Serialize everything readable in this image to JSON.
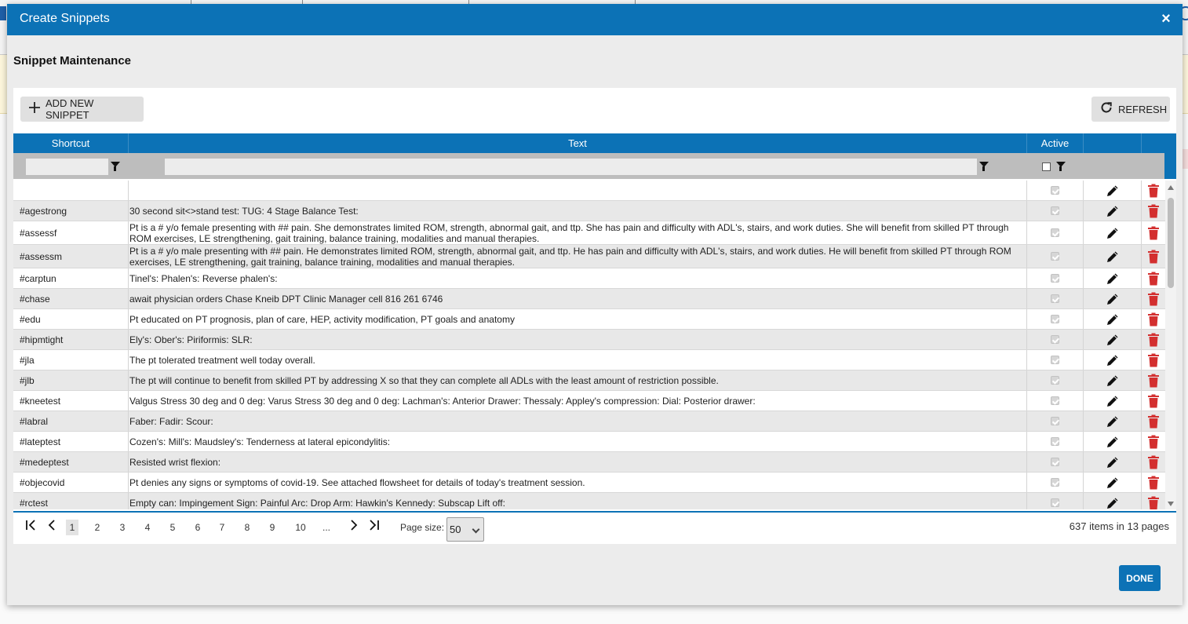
{
  "dialog": {
    "title": "Create Snippets",
    "close_glyph": "×",
    "section_title": "Snippet Maintenance",
    "done_label": "DONE"
  },
  "toolbar": {
    "add_label": "ADD NEW SNIPPET",
    "add_icon": "plus-icon",
    "refresh_label": "REFRESH",
    "refresh_icon": "refresh-icon"
  },
  "grid": {
    "columns": [
      "Shortcut",
      "Text",
      "Active"
    ],
    "rows": [
      {
        "shortcut": "",
        "text": "",
        "active": true
      },
      {
        "shortcut": "#agestrong",
        "text": "30 second sit<>stand test: TUG: 4 Stage Balance Test:",
        "active": true
      },
      {
        "shortcut": "#assessf",
        "text": "Pt is a # y/o female presenting with ## pain. She demonstrates limited ROM, strength, abnormal gait, and ttp. She has pain and difficulty with ADL's, stairs, and work duties. She will benefit from skilled PT through ROM exercises, LE strengthening, gait training, balance training, modalities and manual therapies.",
        "active": true
      },
      {
        "shortcut": "#assessm",
        "text": "Pt is a # y/o male presenting with ## pain. He demonstrates limited ROM, strength, abnormal gait, and ttp. He has pain and difficulty with ADL's, stairs, and work duties. He will benefit from skilled PT through ROM exercises, LE strengthening, gait training, balance training, modalities and manual therapies.",
        "active": true
      },
      {
        "shortcut": "#carptun",
        "text": "Tinel's: Phalen's: Reverse phalen's:",
        "active": true
      },
      {
        "shortcut": "#chase",
        "text": "await physician orders Chase Kneib DPT Clinic Manager cell 816 261 6746",
        "active": true
      },
      {
        "shortcut": "#edu",
        "text": "Pt educated on PT prognosis, plan of care, HEP, activity modification, PT goals and anatomy",
        "active": true
      },
      {
        "shortcut": "#hipmtight",
        "text": "Ely's: Ober's: Piriformis: SLR:",
        "active": true
      },
      {
        "shortcut": "#jla",
        "text": "The pt tolerated treatment well today overall.",
        "active": true
      },
      {
        "shortcut": "#jlb",
        "text": "The pt will continue to benefit from skilled PT by addressing X so that they can complete all ADLs with the least amount of restriction possible.",
        "active": true
      },
      {
        "shortcut": "#kneetest",
        "text": "Valgus Stress 30 deg and 0 deg: Varus Stress 30 deg and 0 deg: Lachman's: Anterior Drawer: Thessaly: Appley's compression: Dial: Posterior drawer:",
        "active": true
      },
      {
        "shortcut": "#labral",
        "text": "Faber: Fadir: Scour:",
        "active": true
      },
      {
        "shortcut": "#lateptest",
        "text": "Cozen's: Mill's: Maudsley's: Tenderness at lateral epicondylitis:",
        "active": true
      },
      {
        "shortcut": "#medeptest",
        "text": "Resisted wrist flexion:",
        "active": true
      },
      {
        "shortcut": "#objecovid",
        "text": "Pt denies any signs or symptoms of covid-19. See attached flowsheet for details of today's treatment session.",
        "active": true
      },
      {
        "shortcut": "#rctest",
        "text": "Empty can: Impingement Sign: Painful Arc: Drop Arm: Hawkin's Kennedy: Subscap Lift off:",
        "active": true
      }
    ]
  },
  "pager": {
    "first": "|<",
    "prev": "<",
    "pages": [
      "1",
      "2",
      "3",
      "4",
      "5",
      "6",
      "7",
      "8",
      "9",
      "10",
      "..."
    ],
    "current_page": "1",
    "next": ">",
    "last": ">|",
    "page_size_label": "Page size:",
    "page_size_value": "50",
    "info": "637 items in 13 pages"
  },
  "colors": {
    "primary": "#0c72b6",
    "delete": "#d32f2f",
    "dialog_bg": "#ececec"
  }
}
